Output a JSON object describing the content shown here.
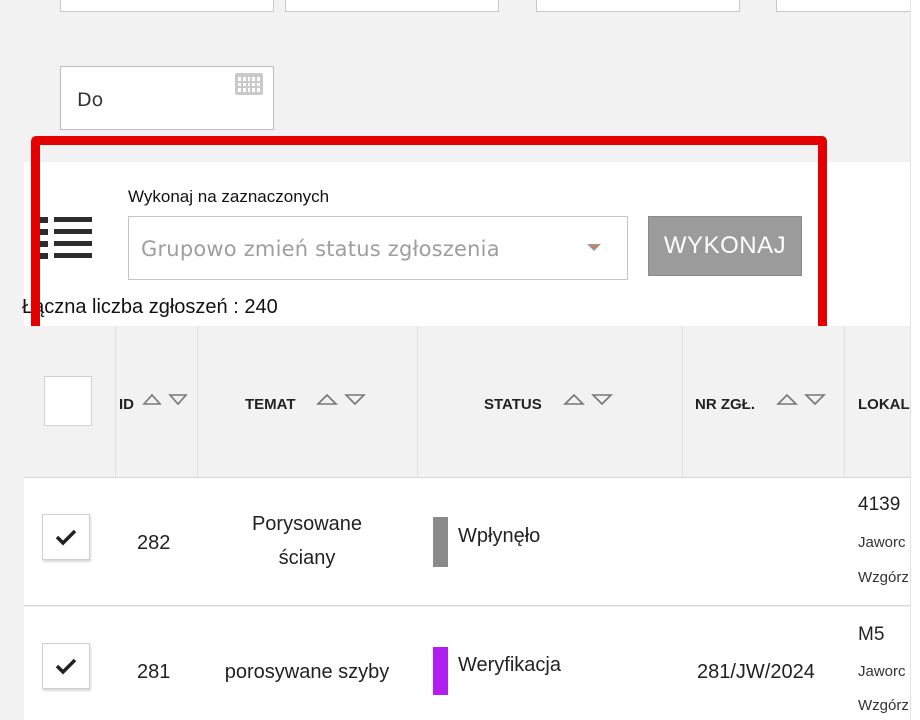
{
  "filters": {
    "date_to_label": "Do"
  },
  "bulk_actions": {
    "label": "Wykonaj na zaznaczonych",
    "select_placeholder": "Grupowo zmień status zgłoszenia",
    "execute_button": "WYKONAJ"
  },
  "total": {
    "text": "Łączna liczba zgłoszeń : 240"
  },
  "table": {
    "columns": [
      {
        "key": "id",
        "label": "ID"
      },
      {
        "key": "temat",
        "label": "TEMAT"
      },
      {
        "key": "status",
        "label": "STATUS"
      },
      {
        "key": "nr",
        "label": "NR ZGŁ."
      },
      {
        "key": "lokal",
        "label": "LOKAL"
      }
    ],
    "rows": [
      {
        "checked": true,
        "id": "282",
        "temat_line1": "Porysowane",
        "temat_line2": "ściany",
        "status": "Wpłynęło",
        "status_color": "#8a8a8a",
        "nr": "",
        "lokal_top": "4139",
        "lokal_l2": "Jaworc",
        "lokal_l3": "Wzgórz"
      },
      {
        "checked": true,
        "id": "281",
        "temat_line1": "porosywane szyby",
        "temat_line2": "",
        "status": "Weryfikacja",
        "status_color": "#b01ff0",
        "nr": "281/JW/2024",
        "lokal_top": "M5",
        "lokal_l2": "Jaworc",
        "lokal_l3": "Wzgórz"
      }
    ]
  },
  "colors": {
    "highlight": "#e40000",
    "button_bg": "#9b9b9b",
    "status_wplynelo": "#8a8a8a",
    "status_weryfikacja": "#b01ff0"
  }
}
